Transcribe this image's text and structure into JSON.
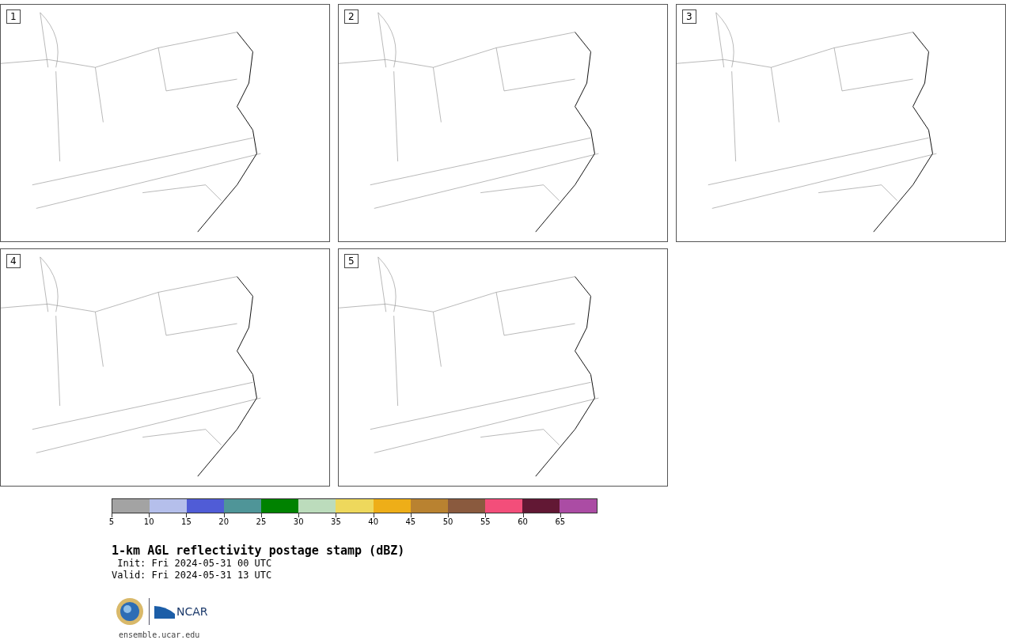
{
  "panels": [
    {
      "label": "1"
    },
    {
      "label": "2"
    },
    {
      "label": "3"
    },
    {
      "label": "4"
    },
    {
      "label": "5"
    }
  ],
  "colorbar": {
    "bins": [
      {
        "label": "5",
        "color": "#a3a3a3"
      },
      {
        "label": "10",
        "color": "#b5bfeb"
      },
      {
        "label": "15",
        "color": "#505cd6"
      },
      {
        "label": "20",
        "color": "#4f9598"
      },
      {
        "label": "25",
        "color": "#008200"
      },
      {
        "label": "30",
        "color": "#bcdcbc"
      },
      {
        "label": "35",
        "color": "#eed85c"
      },
      {
        "label": "40",
        "color": "#eeae18"
      },
      {
        "label": "45",
        "color": "#b98230"
      },
      {
        "label": "50",
        "color": "#8a5a3e"
      },
      {
        "label": "55",
        "color": "#f34e7a"
      },
      {
        "label": "60",
        "color": "#621834"
      },
      {
        "label": "65",
        "color": "#ab4ca4"
      }
    ]
  },
  "title": "1-km AGL reflectivity postage stamp (dBZ)",
  "init": " Init: Fri 2024-05-31 00 UTC",
  "valid": "Valid: Fri 2024-05-31 13 UTC",
  "logo": {
    "text": "NCAR"
  },
  "url": "ensemble.ucar.edu"
}
